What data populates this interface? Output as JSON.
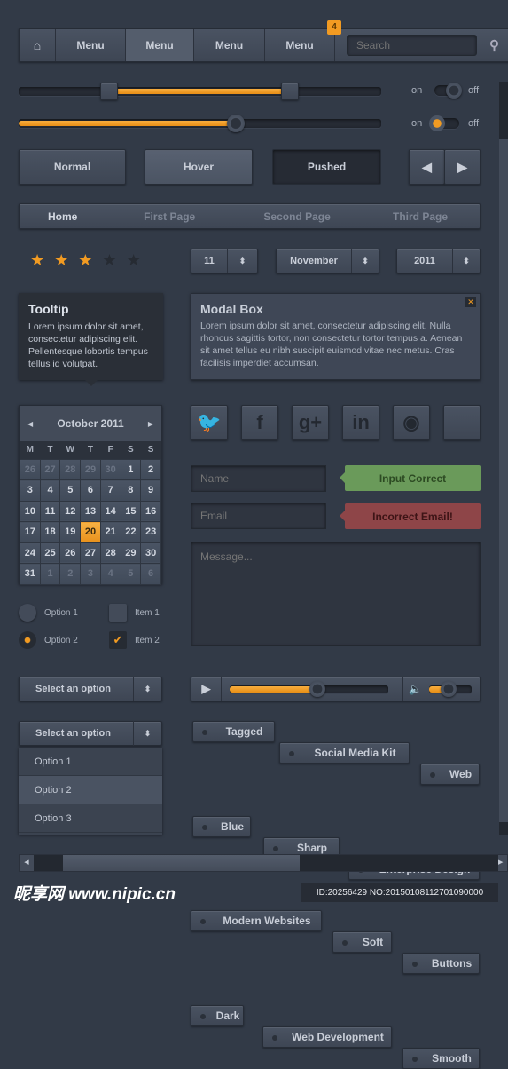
{
  "nav": {
    "home_icon": "home-icon",
    "items": [
      "Menu",
      "Menu",
      "Menu",
      "Menu"
    ],
    "active_index": 1,
    "badge": "4",
    "search_placeholder": "Search",
    "search_icon": "search-icon"
  },
  "range_slider": {
    "low": 0.25,
    "high": 0.75
  },
  "slider": {
    "value": 0.6
  },
  "toggles": [
    {
      "on": "on",
      "off": "off",
      "state": "off"
    },
    {
      "on": "on",
      "off": "off",
      "state": "on"
    }
  ],
  "buttons": {
    "normal": "Normal",
    "hover": "Hover",
    "pushed": "Pushed",
    "prev_icon": "triangle-left-icon",
    "next_icon": "triangle-right-icon"
  },
  "breadcrumb": [
    "Home",
    "First Page",
    "Second Page",
    "Third Page"
  ],
  "rating": {
    "value": 3,
    "max": 5
  },
  "spinners": {
    "day": "11",
    "month": "November",
    "year": "2011"
  },
  "tooltip": {
    "title": "Tooltip",
    "text": "Lorem ipsum dolor sit amet, consectetur adipiscing elit. Pellentesque lobortis tempus tellus id volutpat."
  },
  "modal": {
    "title": "Modal Box",
    "text": "Lorem ipsum dolor sit amet, consectetur adipiscing elit. Nulla rhoncus sagittis tortor, non consectetur tortor tempus a. Aenean sit amet tellus eu nibh suscipit euismod vitae nec metus. Cras facilisis imperdiet accumsan.",
    "close": "✕"
  },
  "calendar": {
    "title": "October 2011",
    "days": [
      "M",
      "T",
      "W",
      "T",
      "F",
      "S",
      "S"
    ],
    "rows": [
      [
        "26",
        "27",
        "28",
        "29",
        "30",
        "1",
        "2"
      ],
      [
        "3",
        "4",
        "5",
        "6",
        "7",
        "8",
        "9"
      ],
      [
        "10",
        "11",
        "12",
        "13",
        "14",
        "15",
        "16"
      ],
      [
        "17",
        "18",
        "19",
        "20",
        "21",
        "22",
        "23"
      ],
      [
        "24",
        "25",
        "26",
        "27",
        "28",
        "29",
        "30"
      ],
      [
        "31",
        "1",
        "2",
        "3",
        "4",
        "5",
        "6"
      ]
    ],
    "today": "20"
  },
  "social": [
    "twitter",
    "f",
    "g+",
    "in",
    "rss",
    ""
  ],
  "form": {
    "name_placeholder": "Name",
    "email_placeholder": "Email",
    "message_placeholder": "Message...",
    "success": "Input Correct",
    "error": "Incorrect Email!",
    "success_color": "#6a9a5a",
    "error_color": "#8e4548"
  },
  "radios": [
    "Option 1",
    "Option 2"
  ],
  "radio_selected": 1,
  "checkboxes": [
    "Item 1",
    "Item 2"
  ],
  "checkbox_checked": [
    false,
    true
  ],
  "select": {
    "label": "Select an option",
    "label2": "Select an option",
    "options": [
      "Option 1",
      "Option 2",
      "Option 3"
    ],
    "hovered": 1
  },
  "player": {
    "progress": 0.55,
    "volume": 0.45
  },
  "tags": [
    "Tagged",
    "Social Media Kit",
    "Web",
    "Blue",
    "Sharp",
    "Enterprise Design",
    "Modern Websites",
    "Soft",
    "Buttons",
    "Dark",
    "Web Development",
    "Smooth"
  ],
  "hscroll": {
    "position": 0.1,
    "size": 0.5
  },
  "watermark": {
    "logo": "昵享网 www.nipic.cn",
    "id": "ID:20256429 NO:20150108112701090000"
  },
  "accent": "#f29b22"
}
